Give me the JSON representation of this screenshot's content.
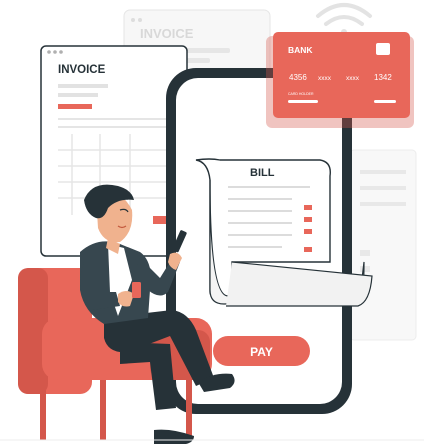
{
  "invoice_back": {
    "title": "INVOICE"
  },
  "invoice_front": {
    "title": "INVOICE"
  },
  "bill": {
    "title": "BILL"
  },
  "card": {
    "bank_label": "BANK",
    "number": [
      "4356",
      "xxxx",
      "xxxx",
      "1342"
    ],
    "holder_label": "CARD HOLDER"
  },
  "pay_button": {
    "label": "PAY"
  },
  "colors": {
    "accent": "#e8675a",
    "accent_dark": "#d4574b",
    "dark": "#263238",
    "light_gray": "#f2f2f2",
    "line_gray": "#dcdcdc"
  }
}
